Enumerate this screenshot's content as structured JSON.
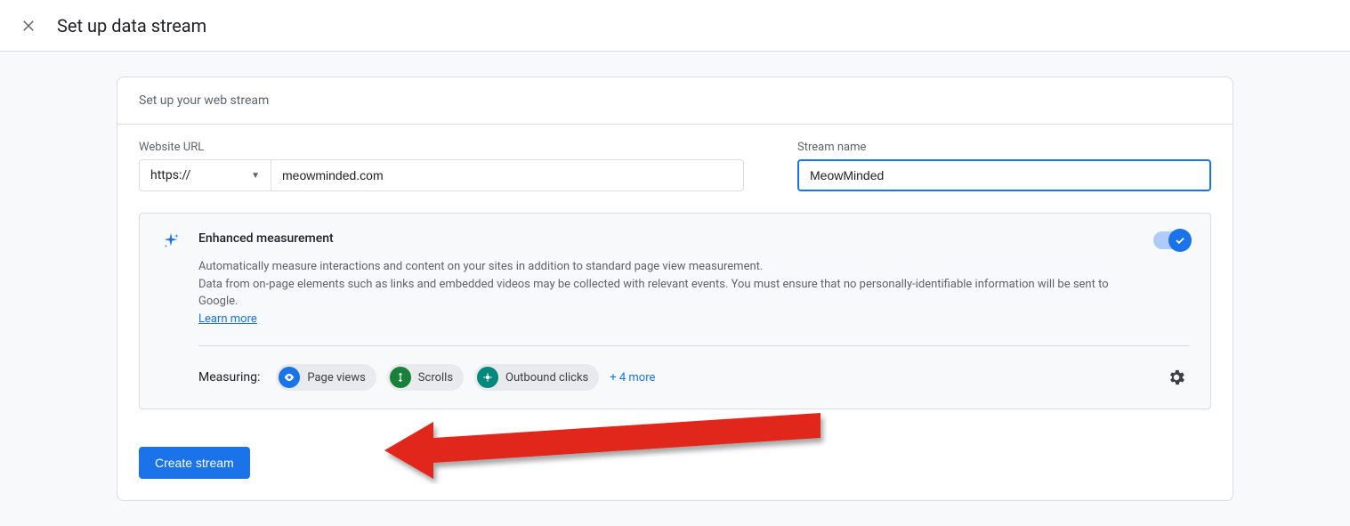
{
  "topbar": {
    "title": "Set up data stream"
  },
  "panel": {
    "header": "Set up your web stream"
  },
  "form": {
    "url_label": "Website URL",
    "protocol": "https://",
    "url_value": "meowminded.com",
    "stream_label": "Stream name",
    "stream_value": "MeowMinded"
  },
  "enhanced": {
    "title": "Enhanced measurement",
    "desc1": "Automatically measure interactions and content on your sites in addition to standard page view measurement.",
    "desc2": "Data from on-page elements such as links and embedded videos may be collected with relevant events. You must ensure that no personally-identifiable information will be sent to Google.",
    "learn_more": "Learn more",
    "measuring_label": "Measuring:",
    "chips": [
      {
        "label": "Page views"
      },
      {
        "label": "Scrolls"
      },
      {
        "label": "Outbound clicks"
      }
    ],
    "more": "+ 4 more"
  },
  "footer": {
    "create": "Create stream"
  }
}
